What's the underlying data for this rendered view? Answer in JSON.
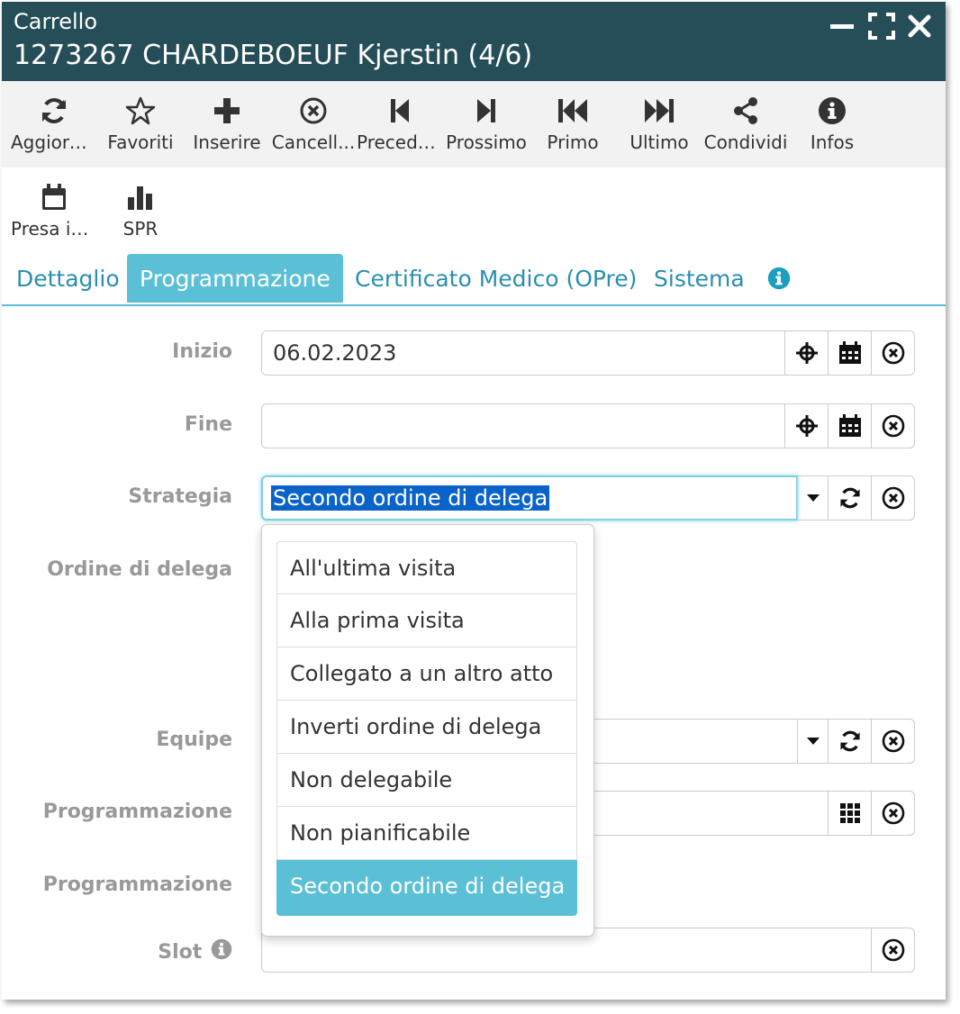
{
  "window": {
    "title": "Carrello",
    "subtitle": "1273267 CHARDEBOEUF Kjerstin (4/6)"
  },
  "toolbar": [
    {
      "label": "Aggiorn...",
      "icon": "refresh-icon"
    },
    {
      "label": "Favoriti",
      "icon": "star-icon"
    },
    {
      "label": "Inserire",
      "icon": "plus-icon"
    },
    {
      "label": "Cancell...",
      "icon": "cancel-circle-icon"
    },
    {
      "label": "Precede...",
      "icon": "step-backward-icon"
    },
    {
      "label": "Prossimo",
      "icon": "step-forward-icon"
    },
    {
      "label": "Primo",
      "icon": "fast-backward-icon"
    },
    {
      "label": "Ultimo",
      "icon": "fast-forward-icon"
    },
    {
      "label": "Condividi",
      "icon": "share-icon"
    },
    {
      "label": "Infos",
      "icon": "info-icon"
    },
    {
      "label": "Presa in...",
      "icon": "calendar-icon"
    },
    {
      "label": "SPR",
      "icon": "bar-chart-icon"
    }
  ],
  "tabs": [
    {
      "label": "Dettaglio"
    },
    {
      "label": "Programmazione"
    },
    {
      "label": "Certificato Medico (OPre)"
    },
    {
      "label": "Sistema"
    }
  ],
  "form": {
    "inizio": {
      "label": "Inizio",
      "value": "06.02.2023"
    },
    "fine": {
      "label": "Fine",
      "value": ""
    },
    "strategia": {
      "label": "Strategia",
      "value": "Secondo ordine di delega"
    },
    "ordine": {
      "label": "Ordine di delega"
    },
    "equipe": {
      "label": "Equipe",
      "value": ""
    },
    "programmazione1": {
      "label": "Programmazione",
      "value": ""
    },
    "programmazione2": {
      "label": "Programmazione"
    },
    "slot": {
      "label": "Slot",
      "value": ""
    }
  },
  "dropdown": {
    "options": [
      "All'ultima visita",
      "Alla prima visita",
      "Collegato a un altro atto",
      "Inverti ordine di delega",
      "Non delegabile",
      "Non pianificabile",
      "Secondo ordine di delega"
    ],
    "selected": "Secondo ordine di delega"
  },
  "colors": {
    "titlebar": "#264e58",
    "accent": "#5bc0d6",
    "tab_text": "#2a8fb0",
    "selection": "#0a63c8"
  }
}
